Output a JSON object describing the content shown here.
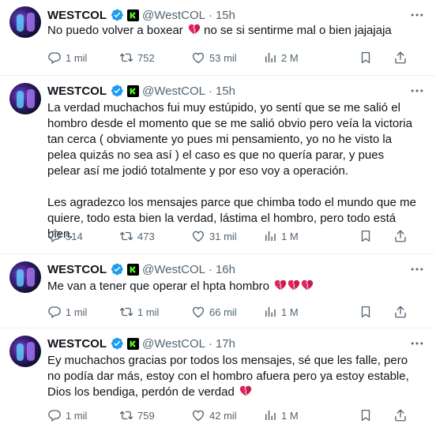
{
  "tweets": [
    {
      "name": "WESTCOL",
      "handle": "@WestCOL",
      "time": "15h",
      "text": "No puedo volver a boxear",
      "text_after": " no se si sentirme mal o bien jajajaja",
      "hearts": 1,
      "replies": "1 mil",
      "retweets": "752",
      "likes": "53 mil",
      "views": "2 M"
    },
    {
      "name": "WESTCOL",
      "handle": "@WestCOL",
      "time": "15h",
      "text": "La verdad muchachos fui muy estúpido, yo sentí que se me salió el hombro desde el momento que se me salió obvio pero veía la victoria tan cerca ( obviamente yo pues mi pensamiento, yo no he visto la pelea quizás no sea así ) el caso es que no quería parar, y pues pelear así me jodió totalmente y por eso voy a operación.\n\nLes agradezco los mensajes parce que chimba todo el mundo que me quiere, todo esta bien la verdad, lástima el hombro, pero todo está bien.",
      "replies": "514",
      "retweets": "473",
      "likes": "31 mil",
      "views": "1 M"
    },
    {
      "name": "WESTCOL",
      "handle": "@WestCOL",
      "time": "16h",
      "text": "Me van a tener que operar el hpta hombro",
      "hearts": 3,
      "replies": "1 mil",
      "retweets": "1 mil",
      "likes": "66 mil",
      "views": "1 M"
    },
    {
      "name": "WESTCOL",
      "handle": "@WestCOL",
      "time": "17h",
      "text": "Ey muchachos gracias por todos los mensajes, sé que les falle, pero no podía dar más, estoy con el hombro afuera pero ya estoy estable, Dios los bendiga, perdón de verdad",
      "hearts": 1,
      "replies": "1 mil",
      "retweets": "759",
      "likes": "42 mil",
      "views": "1 M"
    }
  ],
  "colors": {
    "verified": "#1d9bf0",
    "kick": "#53fc18",
    "muted": "#536471",
    "broken_heart": "#e0245e"
  },
  "icons": [
    "verified-icon",
    "kick-badge-icon",
    "more-icon",
    "reply-icon",
    "retweet-icon",
    "like-icon",
    "views-icon",
    "bookmark-icon",
    "share-icon",
    "broken-heart-icon"
  ]
}
